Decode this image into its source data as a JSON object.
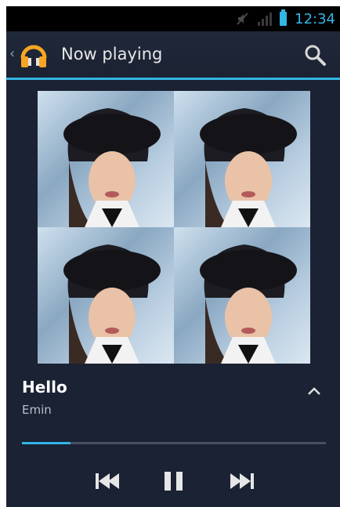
{
  "status_bar": {
    "time": "12:34",
    "icons": [
      "mute-icon",
      "signal-icon",
      "battery-icon"
    ]
  },
  "action_bar": {
    "title": "Now playing",
    "logo": "headphones-icon",
    "search_icon": "search-icon"
  },
  "album_art": {
    "tiles": [
      "album-art-tile",
      "album-art-tile",
      "album-art-tile",
      "album-art-tile"
    ]
  },
  "track": {
    "title": "Hello",
    "artist": "Emin"
  },
  "playback": {
    "progress_fraction": 0.16
  },
  "controls": {
    "prev_icon": "skip-previous-icon",
    "pause_icon": "pause-icon",
    "next_icon": "skip-next-icon"
  },
  "colors": {
    "accent": "#33b5e5",
    "background": "#1a2233"
  }
}
